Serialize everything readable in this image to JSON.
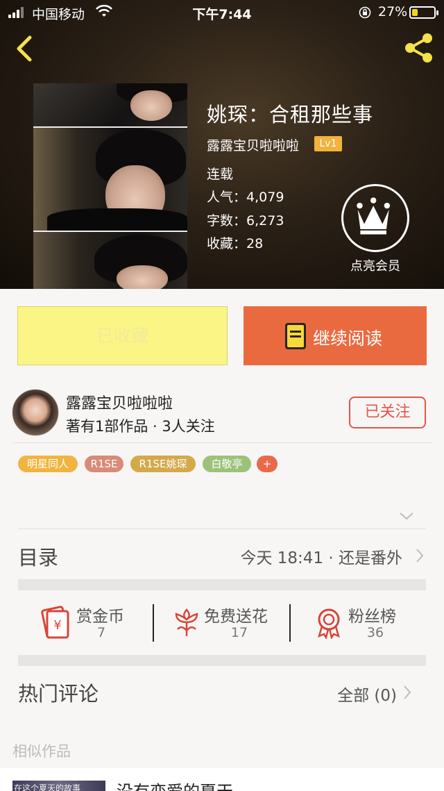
{
  "status_bar": {
    "carrier": "中国移动",
    "time": "下午7:44",
    "battery_percent": "27%",
    "battery_level": 0.27
  },
  "book": {
    "title": "姚琛：合租那些事",
    "author": "露露宝贝啦啦啦",
    "level": "Lv1",
    "status": "连载",
    "popularity_label": "人气：",
    "popularity": "4,079",
    "words_label": "字数：",
    "words": "6,273",
    "favorites_label": "收藏：",
    "favorites": "28"
  },
  "vip": {
    "label": "点亮会员",
    "icon": "crown-icon"
  },
  "actions": {
    "collected_label": "已收藏",
    "read_label": "继续阅读",
    "collected_color": "#fbf586",
    "read_color": "#ea6a3f"
  },
  "author_card": {
    "name": "露露宝贝啦啦啦",
    "summary": "著有1部作品 · 3人关注",
    "follow_label": "已关注"
  },
  "tags": [
    {
      "label": "明星同人",
      "color": "#f0b43f"
    },
    {
      "label": "R1SE",
      "color": "#d98a78"
    },
    {
      "label": "R1SE姚琛",
      "color": "#d4a94a"
    },
    {
      "label": "白敬亭",
      "color": "#9cc27a"
    },
    {
      "label": "+",
      "color": "#e86a4a"
    }
  ],
  "catalog": {
    "title": "目录",
    "latest": "今天 18:41 · 还是番外"
  },
  "stats": [
    {
      "label": "赏金币",
      "count": "7",
      "icon": "red-envelope-icon"
    },
    {
      "label": "免费送花",
      "count": "17",
      "icon": "flower-icon"
    },
    {
      "label": "粉丝榜",
      "count": "36",
      "icon": "medal-icon"
    }
  ],
  "comments": {
    "title": "热门评论",
    "all_label": "全部 (0)"
  },
  "similar": {
    "label": "相似作品",
    "item_title": "没有恋爱的夏天",
    "thumb_text": "在这个夏天的故事"
  }
}
